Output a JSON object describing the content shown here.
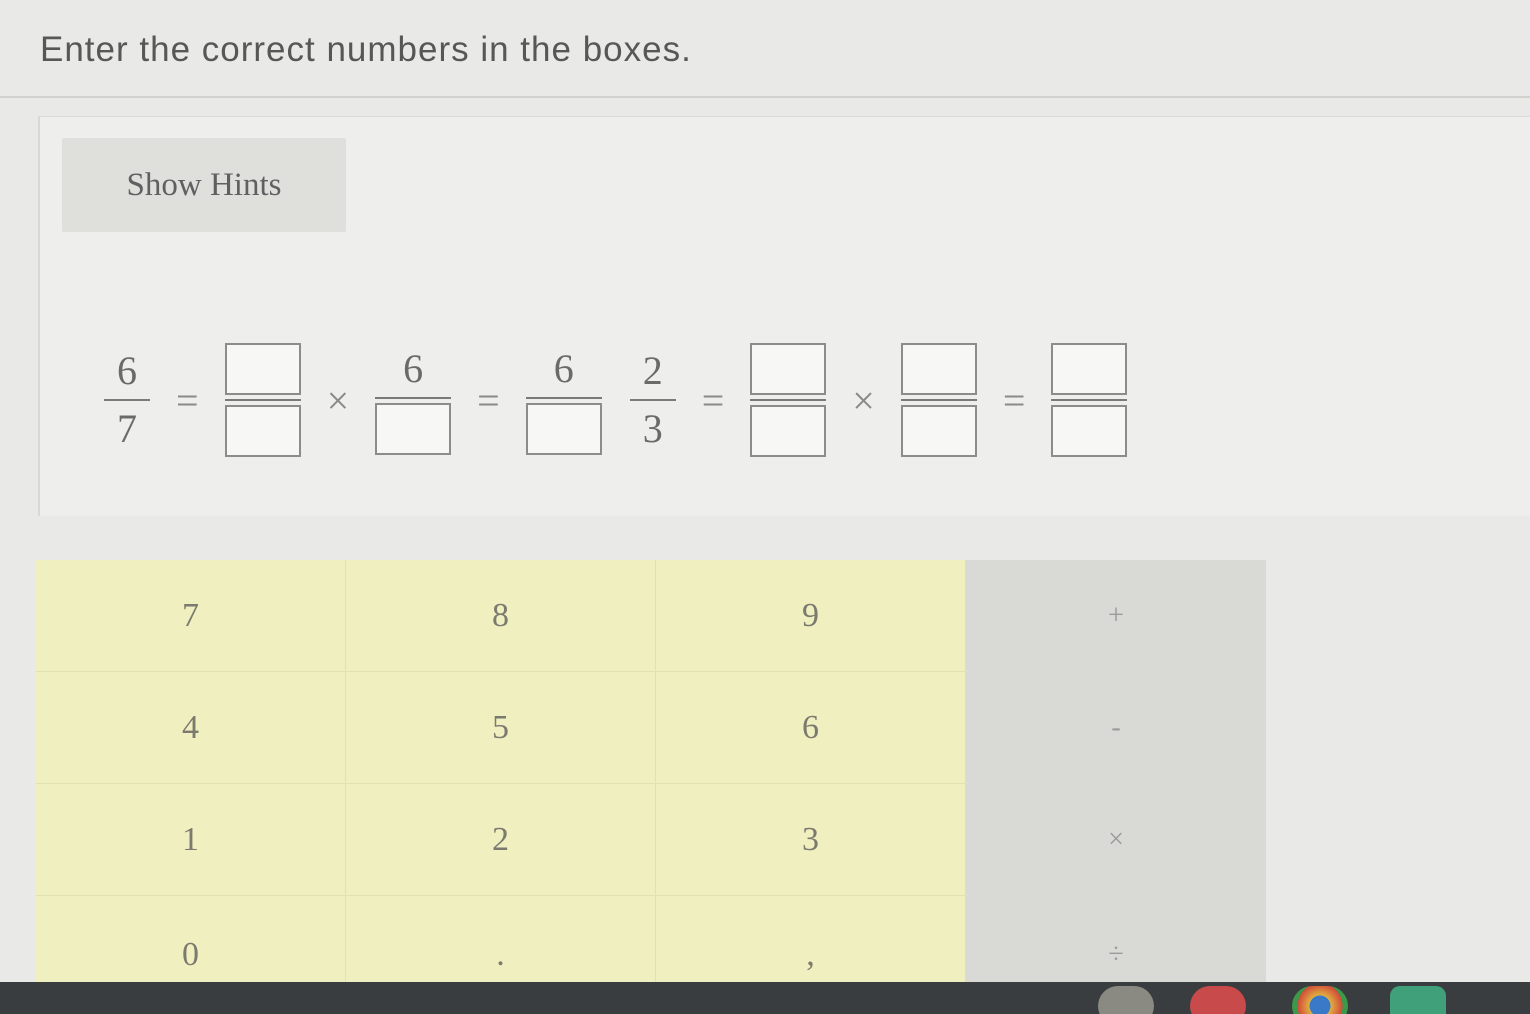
{
  "instruction": "Enter the correct numbers in the boxes.",
  "hints_button": "Show Hints",
  "equation": {
    "lhs_num": "6",
    "lhs_den": "7",
    "eq": "=",
    "times": "×",
    "mid_num": "6",
    "right_num": "6",
    "frac2_num": "2",
    "frac2_den": "3"
  },
  "keypad": {
    "digits": [
      "7",
      "8",
      "9",
      "4",
      "5",
      "6",
      "1",
      "2",
      "3",
      "0",
      ".",
      ","
    ],
    "operators": [
      "+",
      "-",
      "×",
      "÷"
    ]
  },
  "colors": {
    "numpad_bg": "#efefbf",
    "opspad_bg": "#d9d9d6",
    "taskbar": "#3a3d40"
  }
}
